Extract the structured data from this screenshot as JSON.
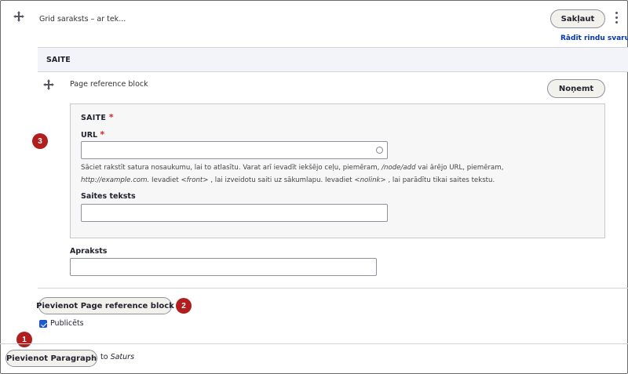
{
  "top_row": {
    "title": "Grid saraksts – ar tek...",
    "collapse_button": "Sakļaut",
    "show_weights_link": "Rādīt rindu svaru"
  },
  "field_section": {
    "header": "SAITE"
  },
  "paragraph": {
    "title": "Page reference block",
    "remove_button": "Noņemt",
    "link_fieldset": {
      "legend": "SAITE",
      "url_label": "URL",
      "url_value": "",
      "desc_1": "Sāciet rakstīt satura nosaukumu, lai to atlasītu. Varat arī ievadīt iekšējo ceļu, piemēram,",
      "desc_path": "/node/add",
      "desc_2": "vai ārējo URL, piemēram,",
      "desc_url": "http://example.com.",
      "desc_3": "Ievadiet",
      "desc_front": "<front>",
      "desc_4": ", lai izveidotu saiti uz sākumlapu. Ievadiet",
      "desc_nolink": "<nolink>",
      "desc_5": ", lai parādītu tikai saites tekstu.",
      "link_text_label": "Saites teksts",
      "link_text_value": ""
    },
    "description_label": "Apraksts",
    "description_value": ""
  },
  "add_block_button": "Pievienot Page reference block",
  "published": {
    "label": "Publicēts",
    "checked": true
  },
  "add_paragraph_button": "Pievienot Paragraph",
  "to_word": "to",
  "target_name": "Saturs",
  "badges": {
    "one": "1",
    "two": "2",
    "three": "3"
  },
  "colors": {
    "badge": "#b01e1e",
    "link": "#0036b1",
    "checkbox": "#1e5bd6",
    "required": "#d72222"
  }
}
